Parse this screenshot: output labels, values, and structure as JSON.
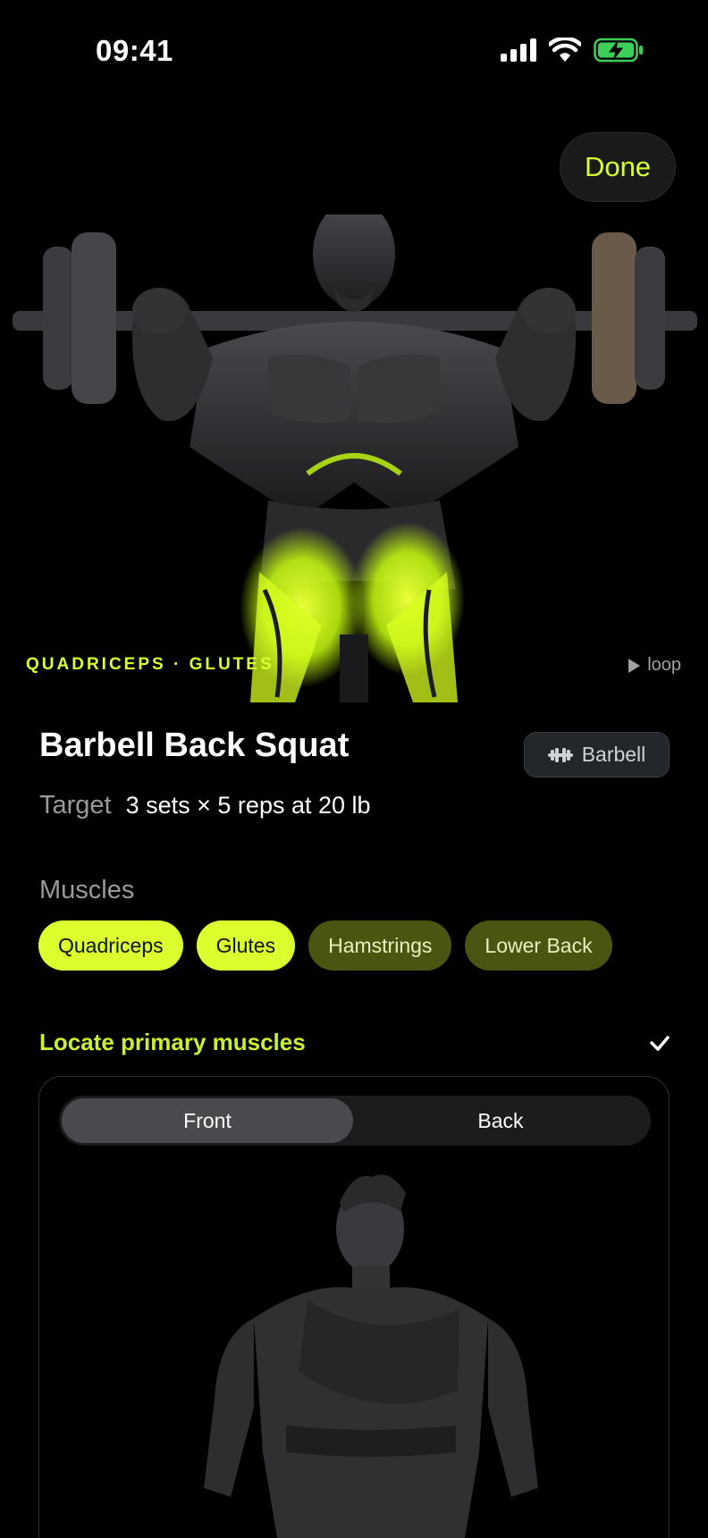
{
  "status": {
    "time": "09:41"
  },
  "header": {
    "done_label": "Done"
  },
  "hero": {
    "muscles_caption": "QUADRICEPS · GLUTES",
    "loop_label": "loop"
  },
  "exercise": {
    "title": "Barbell Back Squat",
    "equipment": "Barbell",
    "target_label": "Target",
    "target_value": "3 sets × 5 reps at 20 lb"
  },
  "muscles": {
    "heading": "Muscles",
    "chips": [
      {
        "label": "Quadriceps",
        "kind": "primary"
      },
      {
        "label": "Glutes",
        "kind": "primary"
      },
      {
        "label": "Hamstrings",
        "kind": "secondary"
      },
      {
        "label": "Lower Back",
        "kind": "secondary"
      }
    ]
  },
  "locate": {
    "label": "Locate primary muscles",
    "segments": [
      "Front",
      "Back"
    ],
    "selected": "Front"
  },
  "colors": {
    "accent": "#d8ff2e",
    "secondary_chip": "#4a5512",
    "background": "#000000"
  }
}
